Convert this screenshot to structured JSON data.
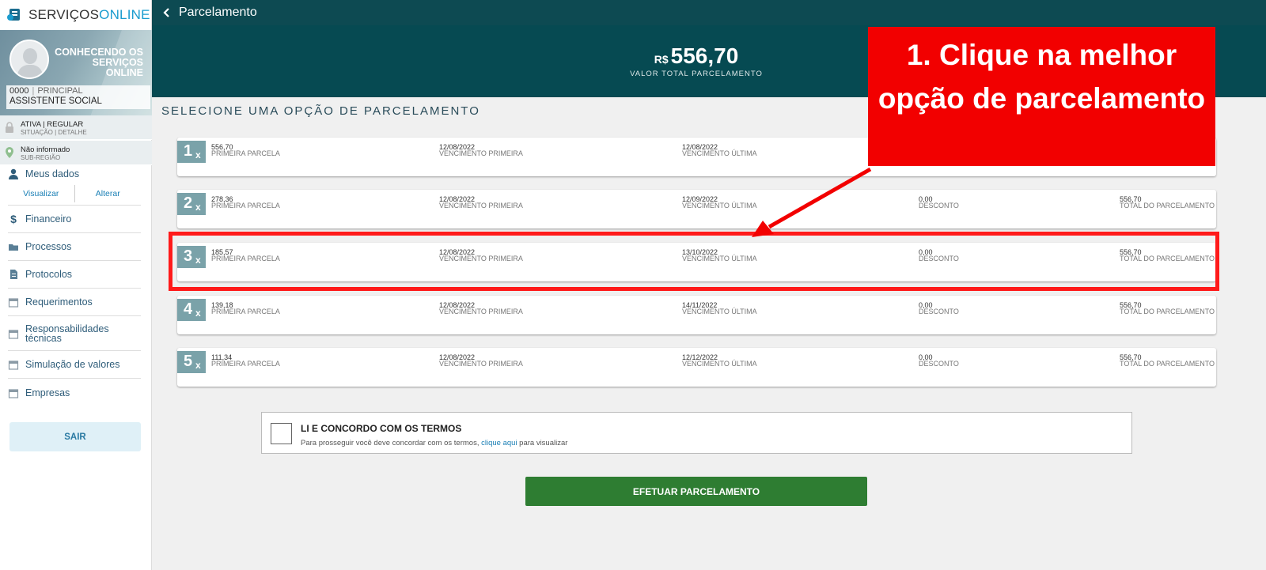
{
  "brand": {
    "name_part1": "SERVIÇOS",
    "name_part2": "ONLINE"
  },
  "profile": {
    "title": "CONHECENDO OS SERVIÇOS ONLINE",
    "code": "0000",
    "kind": "PRINCIPAL",
    "role": "ASSISTENTE SOCIAL"
  },
  "status": {
    "main": "ATIVA | REGULAR",
    "sub": "SITUAÇÃO | DETALHE"
  },
  "region": {
    "main": "Não informado",
    "sub": "SUB-REGIÃO"
  },
  "nav": {
    "meus_dados": "Meus dados",
    "visualizar": "Visualizar",
    "alterar": "Alterar",
    "items": [
      "Financeiro",
      "Processos",
      "Protocolos",
      "Requerimentos",
      "Responsabilidades técnicas",
      "Simulação de valores",
      "Empresas"
    ],
    "logout": "SAIR"
  },
  "topbar": {
    "title": "Parcelamento"
  },
  "header": {
    "currency": "R$",
    "total": "556,70",
    "total_label": "VALOR TOTAL PARCELAMENTO"
  },
  "section_title": "SELECIONE UMA OPÇÃO DE PARCELAMENTO",
  "labels": {
    "primeira": "PRIMEIRA PARCELA",
    "venc_primeira": "VENCIMENTO PRIMEIRA",
    "venc_ultima": "VENCIMENTO ÚLTIMA",
    "desconto": "DESCONTO",
    "total": "TOTAL DO PARCELAMENTO"
  },
  "options": [
    {
      "n": "1",
      "x": "x",
      "primeira": "556,70",
      "venc_primeira": "12/08/2022",
      "venc_ultima": "12/08/2022",
      "desconto": "",
      "total": ""
    },
    {
      "n": "2",
      "x": "x",
      "primeira": "278,36",
      "venc_primeira": "12/08/2022",
      "venc_ultima": "12/09/2022",
      "desconto": "0,00",
      "total": "556,70"
    },
    {
      "n": "3",
      "x": "x",
      "primeira": "185,57",
      "venc_primeira": "12/08/2022",
      "venc_ultima": "13/10/2022",
      "desconto": "0,00",
      "total": "556,70"
    },
    {
      "n": "4",
      "x": "x",
      "primeira": "139,18",
      "venc_primeira": "12/08/2022",
      "venc_ultima": "14/11/2022",
      "desconto": "0,00",
      "total": "556,70"
    },
    {
      "n": "5",
      "x": "x",
      "primeira": "111,34",
      "venc_primeira": "12/08/2022",
      "venc_ultima": "12/12/2022",
      "desconto": "0,00",
      "total": "556,70"
    }
  ],
  "terms": {
    "title": "LI E CONCORDO COM OS TERMOS",
    "desc_before": "Para prosseguir você deve concordar com os termos, ",
    "link": "clique aqui",
    "desc_after": " para visualizar"
  },
  "submit": "EFETUAR PARCELAMENTO",
  "callout": {
    "text": "1. Clique na melhor opção de parcelamento"
  },
  "colors": {
    "header": "#064a52",
    "callout": "#f20000",
    "submit": "#2e7d32",
    "badge": "#7aa2a9"
  }
}
